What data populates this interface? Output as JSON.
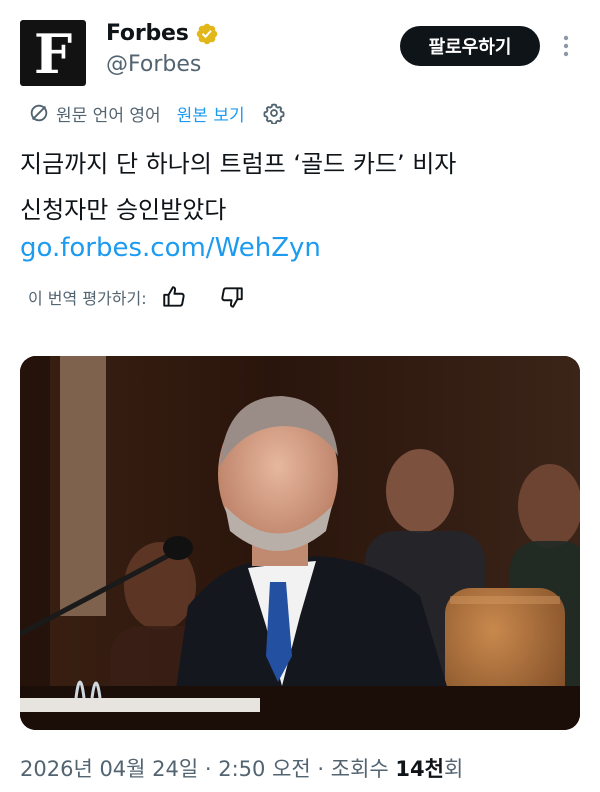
{
  "profile": {
    "avatar_letter": "F",
    "display_name": "Forbes",
    "handle": "@Forbes",
    "verified_badge_icon": "verified-gold-badge-icon",
    "verified_color": "#e2b719"
  },
  "header": {
    "follow_label": "팔로우하기",
    "more_icon": "more-vertical-icon"
  },
  "translation": {
    "icon": "translate-icon",
    "source_language": "원문 언어 영어",
    "show_original_label": "원본 보기",
    "settings_icon": "gear-icon"
  },
  "tweet": {
    "line1": "지금까지 단 하나의 트럼프 ‘골드 카드’ 비자",
    "line2": "신청자만 승인받았다",
    "link": "go.forbes.com/WehZyn"
  },
  "rating": {
    "label": "이 번역 평가하기:",
    "thumbs_up_icon": "thumbs-up-icon",
    "thumbs_down_icon": "thumbs-down-icon"
  },
  "media": {
    "type": "photo"
  },
  "meta": {
    "date": "2026년 04월 24일",
    "separator": " · ",
    "time": "2:50 오전",
    "views_label": "조회수 ",
    "views_count": "14천",
    "views_suffix": "회"
  },
  "colors": {
    "accent": "#1d9bf0",
    "text": "#0f1419",
    "muted": "#536471"
  }
}
